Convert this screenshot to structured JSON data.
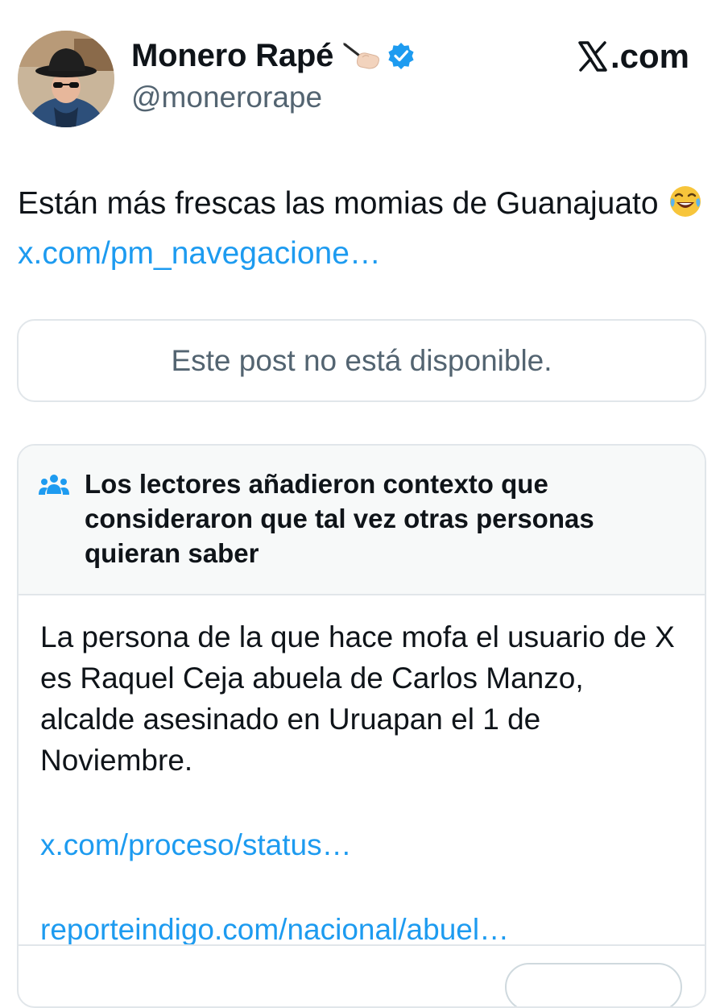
{
  "author": {
    "display_name": "Monero Rapé",
    "name_emoji": "writing-hand-icon",
    "verified": true,
    "verified_color": "#1d9bf0",
    "handle": "@monerorape"
  },
  "brand": {
    "label": ".com",
    "logo": "x-logo-icon"
  },
  "post": {
    "text_before_emoji": "Están más frescas las momias de Guanajuato",
    "emoji": "laughing-icon",
    "link": "x.com/pm_navegacione…"
  },
  "quoted_post": {
    "message": "Este post no está disponible."
  },
  "community_note": {
    "icon": "people-icon",
    "title": "Los lectores añadieron contexto que consideraron que tal vez otras personas quieran saber",
    "body": "La persona de la que hace mofa el usuario de X es Raquel Ceja abuela de Carlos Manzo, alcalde asesinado en Uruapan  el 1 de Noviembre.",
    "links": [
      "x.com/proceso/status…",
      "reporteindigo.com/nacional/abuel…"
    ]
  },
  "colors": {
    "text": "#0f1419",
    "secondary_text": "#536471",
    "link": "#1d9bf0",
    "border": "#e1e6ea",
    "note_header_bg": "#f7f9f9"
  }
}
